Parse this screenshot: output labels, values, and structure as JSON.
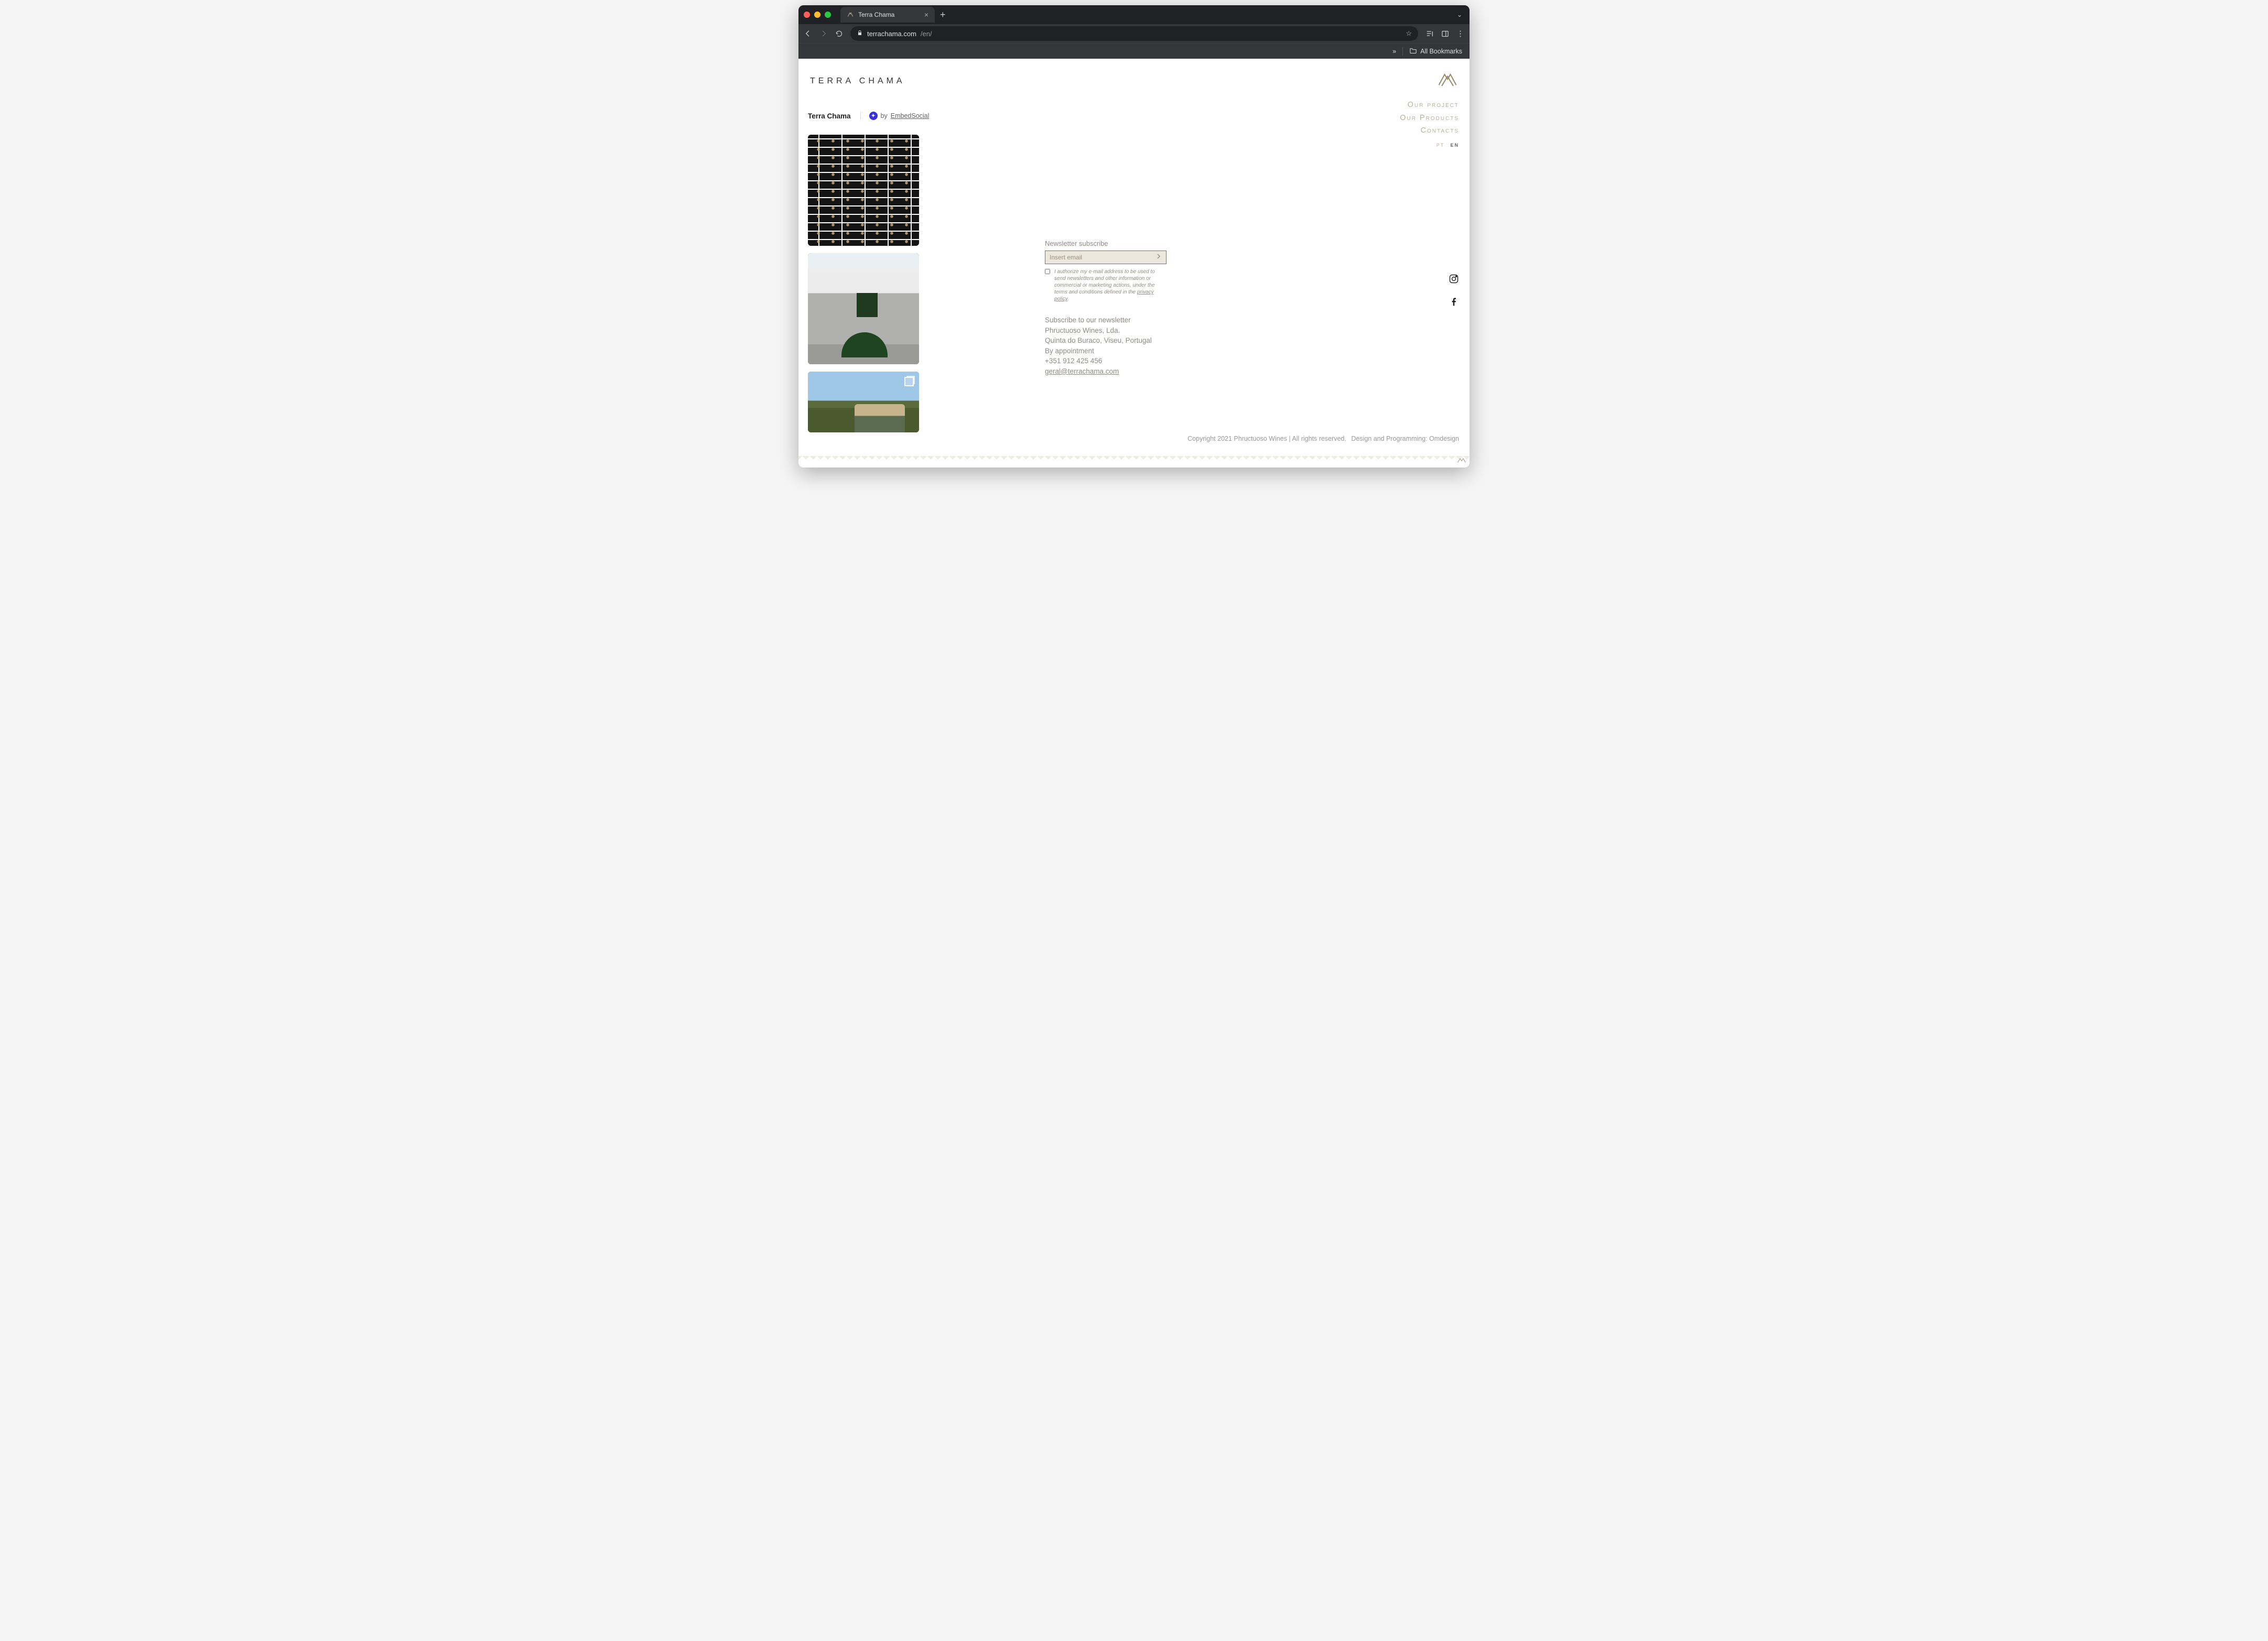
{
  "browser": {
    "tab_title": "Terra Chama",
    "url_host": "terrachama.com",
    "url_path": "/en/",
    "bookmarks_label": "All Bookmarks",
    "overflow": "»"
  },
  "header": {
    "wordmark": "TERRA CHAMA"
  },
  "nav": {
    "project": "Our project",
    "products": "Our Products",
    "contacts": "Contacts",
    "lang_pt": "pt",
    "lang_en": "en"
  },
  "feed": {
    "title": "Terra Chama",
    "by_prefix": "by",
    "by_name": "EmbedSocial"
  },
  "images": [
    {
      "name": "wine-rack"
    },
    {
      "name": "winery-exterior"
    },
    {
      "name": "vineyard-vehicle"
    }
  ],
  "newsletter": {
    "label": "Newsletter subscribe",
    "placeholder": "Insert email",
    "consent_text": "I authorize my e-mail address to be used to send newsletters and other information or commercial or marketing actions, under the terms and conditions defined in the ",
    "privacy_label": "privacy policy",
    "consent_suffix": "."
  },
  "contacts": {
    "line1": "Subscribe to our newsletter",
    "line2": "Phructuoso Wines, Lda.",
    "line3": "Quinta do Buraco, Viseu, Portugal",
    "line4": "By appointment",
    "phone": "+351 912 425 456",
    "email": "geral@terrachama.com"
  },
  "footer": {
    "copyright": "Copyright 2021 Phructuoso Wines | All rights reserved.",
    "design": "Design and Programming: Omdesign"
  }
}
